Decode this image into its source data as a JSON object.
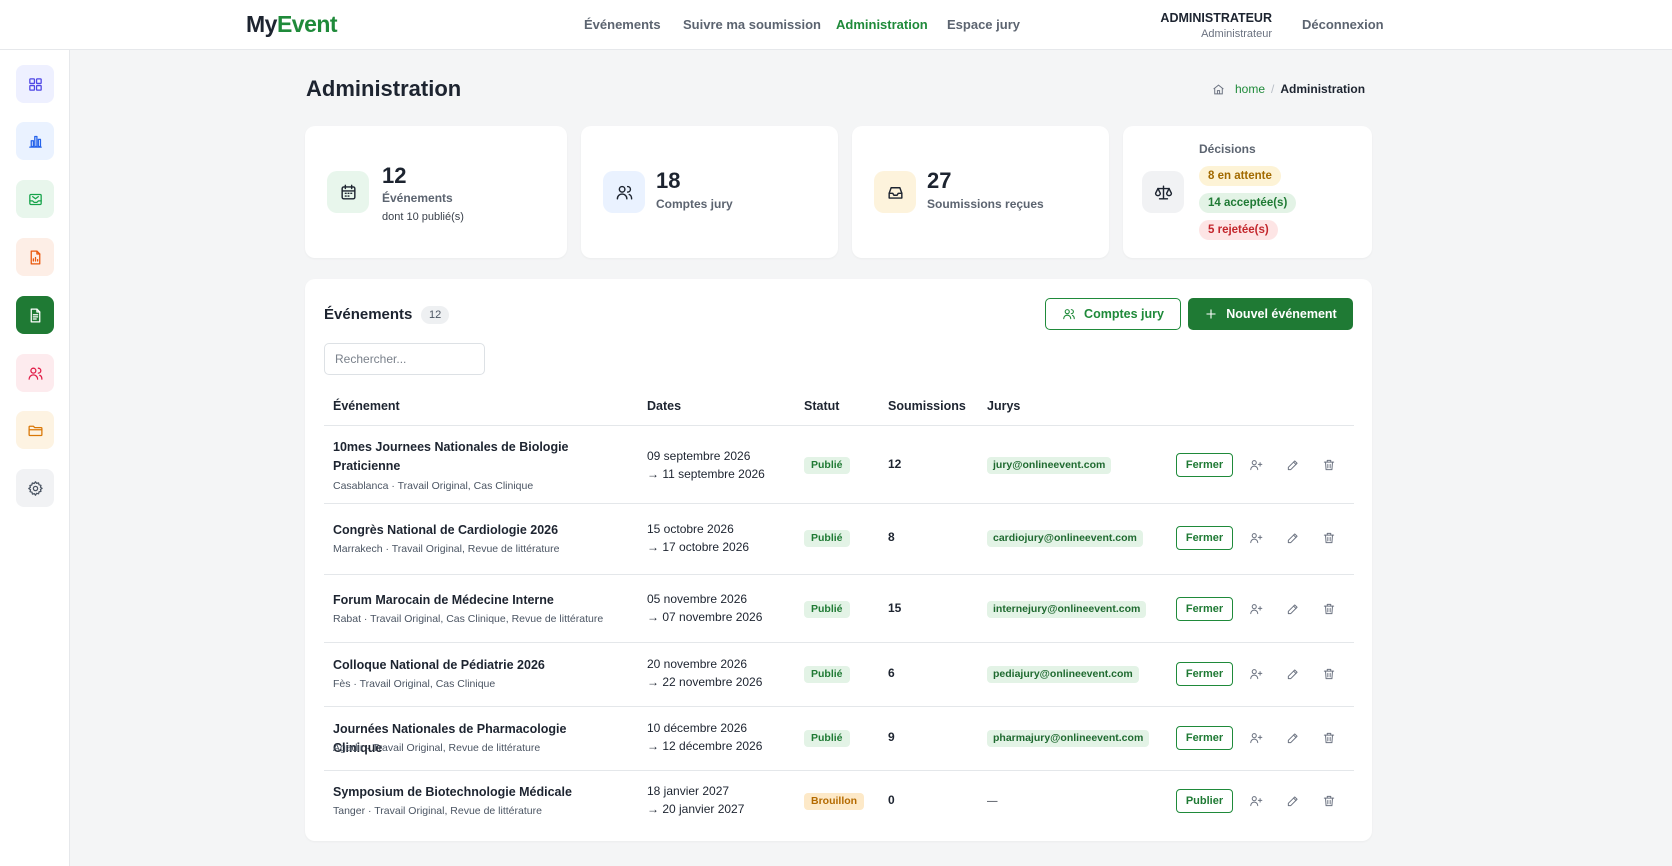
{
  "header": {
    "logo_part1": "My",
    "logo_part2": "Event",
    "nav": [
      "Événements",
      "Suivre ma soumission",
      "Administration",
      "Espace jury"
    ],
    "user_name": "ADMINISTRATEUR",
    "user_role": "Administrateur",
    "logout": "Déconnexion"
  },
  "sidebar": {
    "items": [
      {
        "icon": "grid-icon",
        "color": "#4f46e5",
        "bg": "#eef0ff"
      },
      {
        "icon": "bar-chart-icon",
        "color": "#2563eb",
        "bg": "#eaf2ff"
      },
      {
        "icon": "inbox-mail-icon",
        "color": "#16a34a",
        "bg": "#e8f6ec"
      },
      {
        "icon": "report-file-icon",
        "color": "#ea580c",
        "bg": "#fdeee6"
      },
      {
        "icon": "document-icon",
        "color": "#ffffff",
        "bg": "#1f7a34"
      },
      {
        "icon": "users-icon",
        "color": "#e11d48",
        "bg": "#fdebee"
      },
      {
        "icon": "folder-icon",
        "color": "#d97706",
        "bg": "#fdf3e2"
      },
      {
        "icon": "gear-icon",
        "color": "#4b5563",
        "bg": "#f1f2f4"
      }
    ]
  },
  "page": {
    "title": "Administration",
    "breadcrumb_home": "home",
    "breadcrumb_sep": "/",
    "breadcrumb_current": "Administration"
  },
  "stats": {
    "events": {
      "value": "12",
      "label": "Événements",
      "sub": "dont 10 publié(s)"
    },
    "jury": {
      "value": "18",
      "label": "Comptes jury"
    },
    "submissions": {
      "value": "27",
      "label": "Soumissions reçues"
    },
    "decisions": {
      "title": "Décisions",
      "pending": "8 en attente",
      "accepted": "14 acceptée(s)",
      "rejected": "5 rejetée(s)"
    }
  },
  "events": {
    "title": "Événements",
    "count": "12",
    "jury_button": "Comptes jury",
    "new_button": "Nouvel événement",
    "search_placeholder": "Rechercher...",
    "columns": [
      "Événement",
      "Dates",
      "Statut",
      "Soumissions",
      "Jurys"
    ],
    "rows": [
      {
        "name": "10mes Journees Nationales de Biologie Praticienne",
        "meta": "Casablanca · Travail Original, Cas Clinique",
        "start": "09 septembre 2026",
        "end": "→ 11 septembre 2026",
        "status": "Publié",
        "submissions": "12",
        "jury": "jury@onlineevent.com",
        "action": "Fermer"
      },
      {
        "name": "Congrès National de Cardiologie 2026",
        "meta": "Marrakech · Travail Original, Revue de littérature",
        "start": "15 octobre 2026",
        "end": "→ 17 octobre 2026",
        "status": "Publié",
        "submissions": "8",
        "jury": "cardiojury@onlineevent.com",
        "action": "Fermer"
      },
      {
        "name": "Forum Marocain de Médecine Interne",
        "meta": "Rabat · Travail Original, Cas Clinique, Revue de littérature",
        "start": "05 novembre 2026",
        "end": "→ 07 novembre 2026",
        "status": "Publié",
        "submissions": "15",
        "jury": "internejury@onlineevent.com",
        "action": "Fermer"
      },
      {
        "name": "Colloque National de Pédiatrie 2026",
        "meta": "Fès · Travail Original, Cas Clinique",
        "start": "20 novembre 2026",
        "end": "→ 22 novembre 2026",
        "status": "Publié",
        "submissions": "6",
        "jury": "pediajury@onlineevent.com",
        "action": "Fermer"
      },
      {
        "name": "Journées Nationales de Pharmacologie Clinique",
        "meta": "Agadir · Travail Original, Revue de littérature",
        "start": "10 décembre 2026",
        "end": "→ 12 décembre 2026",
        "status": "Publié",
        "submissions": "9",
        "jury": "pharmajury@onlineevent.com",
        "action": "Fermer"
      },
      {
        "name": "Symposium de Biotechnologie Médicale",
        "meta": "Tanger · Travail Original, Revue de littérature",
        "start": "18 janvier 2027",
        "end": "→ 20 janvier 2027",
        "status": "Brouillon",
        "submissions": "0",
        "jury": "—",
        "action": "Publier"
      }
    ]
  }
}
